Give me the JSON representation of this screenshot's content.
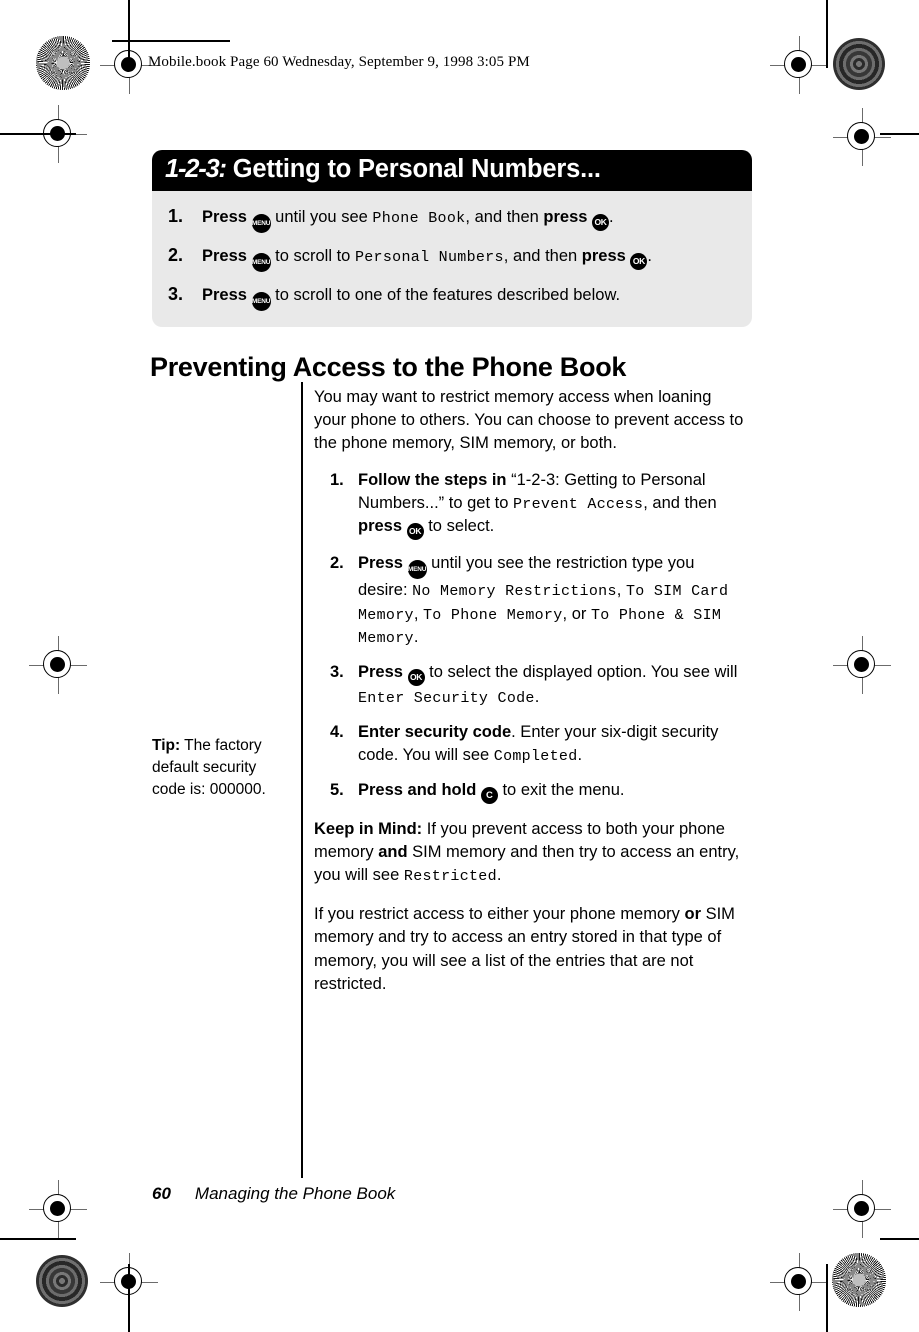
{
  "running_header": "Mobile.book  Page 60  Wednesday, September 9, 1998  3:05 PM",
  "callout": {
    "title_num": "1-2-3:",
    "title_text": "Getting to Personal Numbers...",
    "steps": [
      {
        "num": "1.",
        "lead": "Press",
        "key1": "MENU",
        "mid": "until you see",
        "display1": "Phone Book",
        "mid2": ", and then",
        "lead2": "press",
        "key2": "OK",
        "end": "."
      },
      {
        "num": "2.",
        "lead": "Press",
        "key1": "MENU",
        "mid": "to scroll to",
        "display1": "Personal Numbers",
        "mid2": ", and then",
        "lead2": "press",
        "key2": "OK",
        "end": "."
      },
      {
        "num": "3.",
        "lead": "Press",
        "key1": "MENU",
        "mid": "to scroll to one of the features described below."
      }
    ]
  },
  "section_heading": "Preventing Access to the Phone Book",
  "intro_paragraph": "You may want to restrict memory access when loaning your phone to others. You can choose to prevent access to the phone memory, SIM memory, or both.",
  "procedure": [
    {
      "num": "1.",
      "bold_lead": "Follow the steps in",
      "text_a": "“1-2-3: Getting to Personal Numbers...” to get to",
      "display_a": "Prevent Access",
      "text_b": ", and then",
      "bold_b": "press",
      "key": "OK",
      "text_c": "to  select."
    },
    {
      "num": "2.",
      "bold_lead": "Press",
      "key": "MENU",
      "text_a": "until you see the restriction type you desire:",
      "display_a": "No Memory Restrictions",
      "text_b": ",",
      "display_b": "To SIM Card Memory",
      "text_c": ",",
      "display_c": "To Phone Memory",
      "text_d": ", or",
      "display_d": "To Phone & SIM Memory",
      "text_e": "."
    },
    {
      "num": "3.",
      "bold_lead": "Press",
      "key": "OK",
      "text_a": "to select the displayed option. You see will",
      "display_a": "Enter Security Code",
      "text_b": "."
    },
    {
      "num": "4.",
      "bold_lead": "Enter security code",
      "text_a": ". Enter your six-digit security code. You will see",
      "display_a": "Completed",
      "text_b": "."
    },
    {
      "num": "5.",
      "bold_lead": "Press and hold",
      "key": "C",
      "text_a": "to exit the menu."
    }
  ],
  "tip": {
    "label": "Tip:",
    "text": "The factory default security code is: 000000."
  },
  "keep_in_mind": {
    "label": "Keep in Mind:",
    "text_a": "If you prevent access to both your phone memory",
    "bold_a": "and",
    "text_b": "SIM memory and then try to access an entry, you will see",
    "display_a": "Restricted",
    "text_c": "."
  },
  "closing_paragraph": {
    "text_a": "If you restrict access to either your phone memory",
    "bold_a": "or",
    "text_b": "SIM memory and try to access an entry stored in that type of memory, you will see a list of the entries that are not restricted."
  },
  "footer": {
    "page_number": "60",
    "chapter_title": "Managing the Phone Book"
  }
}
